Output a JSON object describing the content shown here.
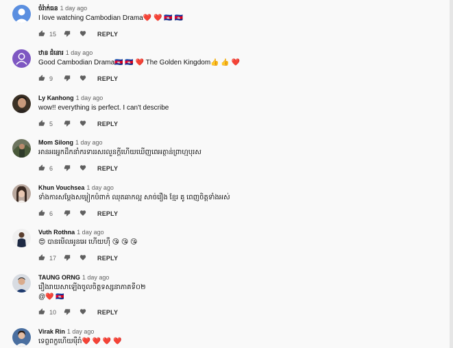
{
  "comments": [
    {
      "author": "ចំរ៉ាក់ធន",
      "date": "1 day ago",
      "text": "I love watching Cambodian Drama❤️ ❤️ 🇰🇭 🇰🇭",
      "text2": "",
      "likes": "15",
      "reply": "REPLY",
      "avatar": "letter-avatar",
      "avatar_color": "#5b8fe0"
    },
    {
      "author": "ឋាន ជំនោរ",
      "date": "1 day ago",
      "text": "Good Cambodian Drama🇰🇭 🇰🇭 ❤️  The Golden Kingdom👍 👍 ❤️",
      "text2": "",
      "likes": "9",
      "reply": "REPLY",
      "avatar": "person-avatar",
      "avatar_color": "#7e57c2"
    },
    {
      "author": "Ly Kanhong",
      "date": "1 day ago",
      "text": "wow!! everything is perfect. I can't describe",
      "text2": "",
      "likes": "5",
      "reply": "REPLY",
      "avatar": "photo-avatar",
      "avatar_color": "#3c3226"
    },
    {
      "author": "Mom Silong",
      "date": "1 day ago",
      "text": "អានអរអ្នកដឹកនាំករទាររសរលួនក្ដីហើយឃើញពេអត្ថាន់ព្រាហ្មបុរស",
      "text2": "",
      "likes": "6",
      "reply": "REPLY",
      "avatar": "photo-avatar",
      "avatar_color": "#6e7560"
    },
    {
      "author": "Khun Vouchsea",
      "date": "1 day ago",
      "text": "ទាំងការសម្ដែងសម្លៀកបំពាក់ ឈុតឆាកល្អ សាច់រឿង ខ្មែរ គូ ពេញចិត្តទាំងអស់",
      "text2": "",
      "likes": "6",
      "reply": "REPLY",
      "avatar": "photo-avatar",
      "avatar_color": "#b9a89e"
    },
    {
      "author": "Vuth Rothna",
      "date": "1 day ago",
      "text": "😍  បានមើលអូនអេ ហើយហ៊ឺ 😘 😘 😘",
      "text2": "",
      "likes": "17",
      "reply": "REPLY",
      "avatar": "photo-avatar",
      "avatar_color": "#f0f0f0"
    },
    {
      "author": "TAUNG ORNG",
      "date": "1 day ago",
      "text": "រឿងរាយសាឡើងចូលចិត្តទស្សនាភាគទី០២",
      "text2": "@❤️ 🇰🇭",
      "likes": "10",
      "reply": "REPLY",
      "avatar": "photo-avatar",
      "avatar_color": "#d8dce2"
    },
    {
      "author": "Virak Rin",
      "date": "1 day ago",
      "text": "ទេព្ចពក្ខហើយម៉ឺរាំ❤️ ❤️ ❤️ ❤️",
      "text2": "",
      "likes": "",
      "reply": "",
      "avatar": "photo-avatar",
      "avatar_color": "#4a6fa0"
    }
  ],
  "icons": {
    "like": "thumbs-up-icon",
    "dislike": "thumbs-down-icon",
    "heart": "heart-icon"
  },
  "colors": {
    "text_secondary": "#606060",
    "background": "#f9f9f9"
  }
}
